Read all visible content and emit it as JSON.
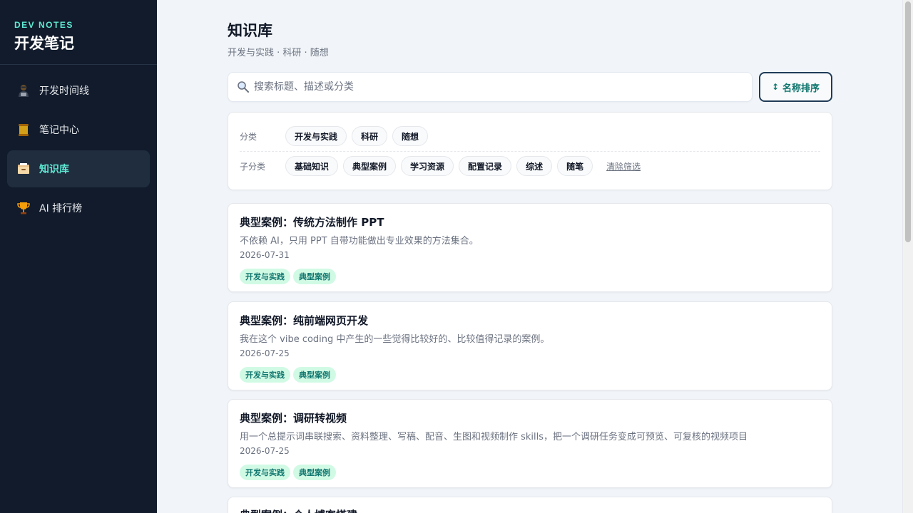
{
  "brand": {
    "en": "DEV NOTES",
    "cn": "开发笔记"
  },
  "nav": [
    {
      "label": "开发时间线",
      "icon": "developer-icon",
      "active": false
    },
    {
      "label": "笔记中心",
      "icon": "scroll-icon",
      "active": false
    },
    {
      "label": "知识库",
      "icon": "file-cabinet-icon",
      "active": true
    },
    {
      "label": "AI 排行榜",
      "icon": "trophy-icon",
      "active": false
    }
  ],
  "page": {
    "title": "知识库",
    "subtitle": "开发与实践 · 科研 · 随想"
  },
  "search": {
    "placeholder": "搜索标题、描述或分类",
    "value": ""
  },
  "sort": {
    "label": "名称排序",
    "arrow": "↕"
  },
  "filters": {
    "category_label": "分类",
    "categories": [
      "开发与实践",
      "科研",
      "随想"
    ],
    "subcategory_label": "子分类",
    "subcategories": [
      "基础知识",
      "典型案例",
      "学习资源",
      "配置记录",
      "综述",
      "随笔"
    ],
    "clear_label": "清除筛选"
  },
  "cards": [
    {
      "title": "典型案例：传统方法制作 PPT",
      "desc": "不依赖 AI，只用 PPT 自带功能做出专业效果的方法集合。",
      "date": "2026-07-31",
      "tags": [
        "开发与实践",
        "典型案例"
      ]
    },
    {
      "title": "典型案例：纯前端网页开发",
      "desc": "我在这个 vibe coding 中产生的一些觉得比较好的、比较值得记录的案例。",
      "date": "2026-07-25",
      "tags": [
        "开发与实践",
        "典型案例"
      ]
    },
    {
      "title": "典型案例：调研转视频",
      "desc": "用一个总提示词串联搜索、资料整理、写稿、配音、生图和视频制作 skills，把一个调研任务变成可预览、可复核的视频项目",
      "date": "2026-07-25",
      "tags": [
        "开发与实践",
        "典型案例"
      ]
    },
    {
      "title": "典型案例：个人博客搭建",
      "desc": "",
      "date": "",
      "tags": []
    }
  ],
  "colors": {
    "accent": "#5eead4",
    "sidebar_bg": "#111b2b",
    "tag_bg": "#d1fae5",
    "tag_fg": "#0f766e"
  }
}
